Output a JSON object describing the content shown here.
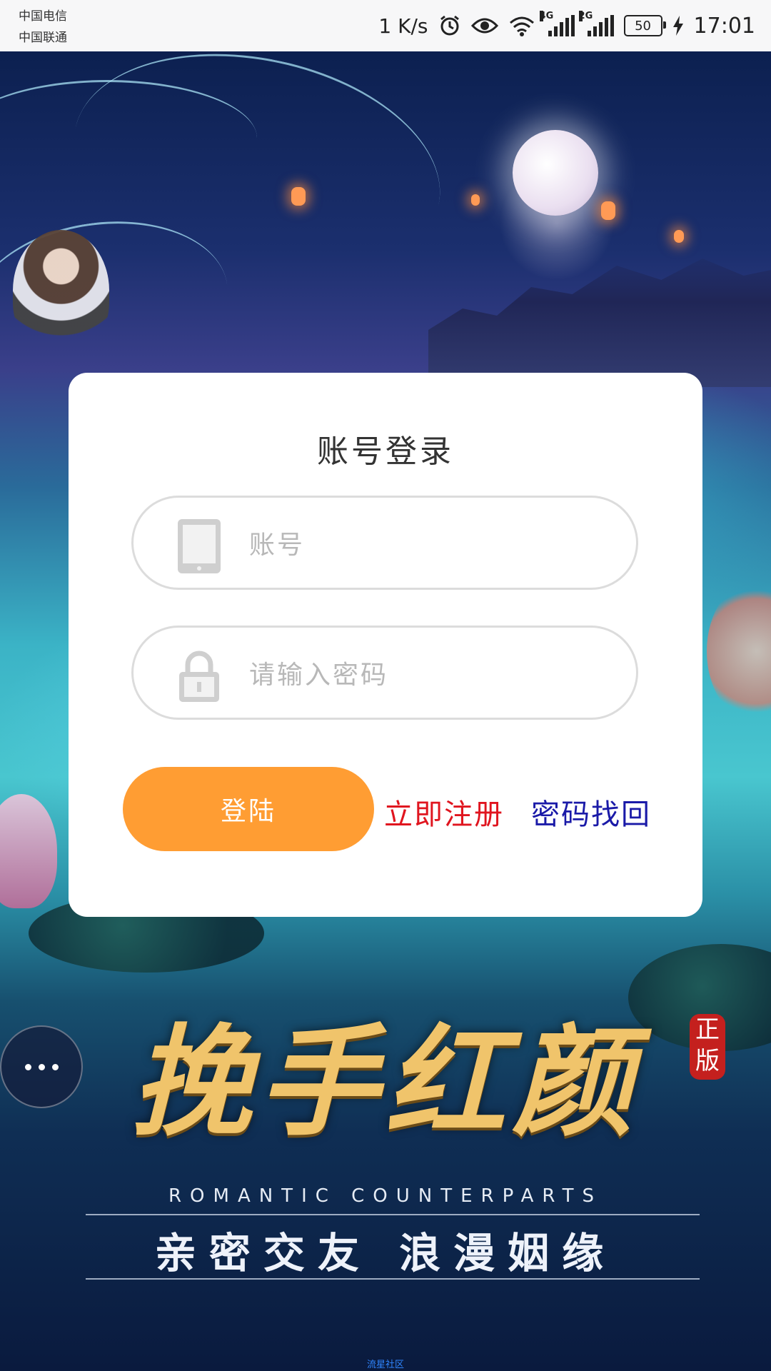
{
  "status_bar": {
    "carrier_1": "中国电信",
    "carrier_2": "中国联通",
    "net_speed": "1 K/s",
    "sim1_net": "4G",
    "sim2_net": "2G",
    "battery": "50",
    "time": "17:01"
  },
  "login": {
    "title": "账号登录",
    "account_placeholder": "账号",
    "password_placeholder": "请输入密码",
    "account_value": "",
    "password_value": "",
    "login_button": "登陆",
    "register_link": "立即注册",
    "forgot_link": "密码找回"
  },
  "banner": {
    "game_title": "挽手红颜",
    "seal": "正版",
    "subtitle_en": "ROMANTIC COUNTERPARTS",
    "slogan": "亲密交友  浪漫姻缘"
  },
  "footer": {
    "text": "流星社区"
  },
  "colors": {
    "login_button": "#ff9d33",
    "register_link": "#e0151f",
    "forgot_link": "#1a1aa8"
  },
  "icons": {
    "account": "phone-icon",
    "password": "lock-icon",
    "floating_menu": "more-dots-icon"
  }
}
